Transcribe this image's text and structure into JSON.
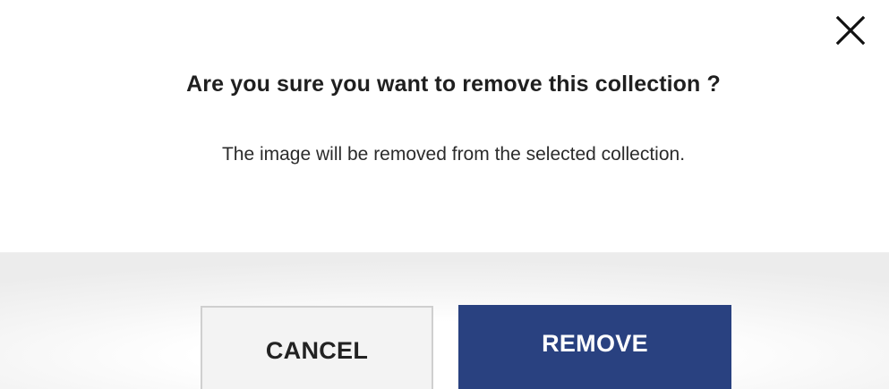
{
  "dialog": {
    "title": "Are you sure you want to remove this collection ?",
    "message": "The image will be removed from the selected collection.",
    "close_icon": "close-icon"
  },
  "buttons": {
    "cancel_label": "CANCEL",
    "remove_label": "REMOVE"
  },
  "colors": {
    "primary": "#294180",
    "cancel_bg": "#f3f3f3",
    "cancel_border": "#cfcfcf",
    "text": "#1f1f1f"
  }
}
